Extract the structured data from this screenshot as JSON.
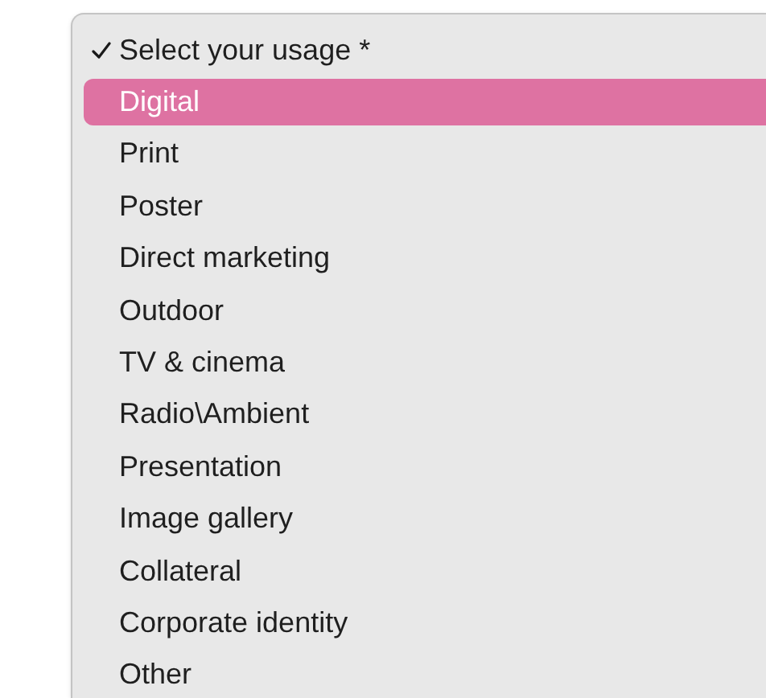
{
  "menu": {
    "options": [
      {
        "label": "Select your usage *",
        "selected": true,
        "highlighted": false
      },
      {
        "label": "Digital",
        "selected": false,
        "highlighted": true
      },
      {
        "label": "Print",
        "selected": false,
        "highlighted": false
      },
      {
        "label": "Poster",
        "selected": false,
        "highlighted": false
      },
      {
        "label": "Direct marketing",
        "selected": false,
        "highlighted": false
      },
      {
        "label": "Outdoor",
        "selected": false,
        "highlighted": false
      },
      {
        "label": "TV & cinema",
        "selected": false,
        "highlighted": false
      },
      {
        "label": "Radio\\Ambient",
        "selected": false,
        "highlighted": false
      },
      {
        "label": "Presentation",
        "selected": false,
        "highlighted": false
      },
      {
        "label": "Image gallery",
        "selected": false,
        "highlighted": false
      },
      {
        "label": "Collateral",
        "selected": false,
        "highlighted": false
      },
      {
        "label": "Corporate identity",
        "selected": false,
        "highlighted": false
      },
      {
        "label": "Other",
        "selected": false,
        "highlighted": false
      }
    ]
  }
}
